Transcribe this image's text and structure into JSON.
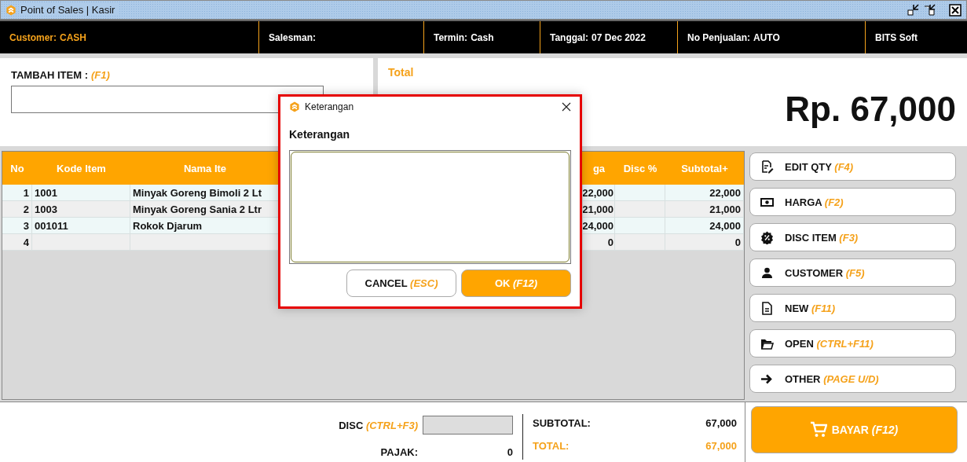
{
  "window": {
    "title": "Point of Sales | Kasir"
  },
  "info_bar": [
    {
      "label": "Customer:",
      "value": "CASH",
      "highlighted": true
    },
    {
      "label": "Salesman:",
      "highlighted": false
    },
    {
      "label": "Termin:",
      "value": "Cash",
      "highlighted": false
    },
    {
      "label": "Tanggal:",
      "value": "07 Dec 2022",
      "highlighted": false
    },
    {
      "label": "No Penjualan:",
      "value": "AUTO",
      "highlighted": false
    },
    {
      "label": "BITS Soft",
      "highlighted": false
    }
  ],
  "add_item": {
    "label": "TAMBAH ITEM :",
    "shortcut": "(F1)"
  },
  "total": {
    "label": "Total",
    "amount": "Rp. 67,000"
  },
  "table": {
    "columns": [
      "No",
      "Kode Item",
      "Nama Ite",
      "ga",
      "Disc %",
      "Subtotal+"
    ],
    "rows": [
      {
        "no": "1",
        "code": "1001",
        "name": "Minyak Goreng Bimoli 2 Lt",
        "price": "22,000",
        "subtotal": "22,000"
      },
      {
        "no": "2",
        "code": "1003",
        "name": "Minyak Goreng Sania 2 Ltr",
        "price": "21,000",
        "subtotal": "21,000"
      },
      {
        "no": "3",
        "code": "001011",
        "name": "Rokok Djarum",
        "price": "24,000",
        "subtotal": "24,000"
      },
      {
        "no": "4",
        "price": "0",
        "subtotal": "0"
      }
    ]
  },
  "actions": [
    {
      "label": "EDIT QTY",
      "shortcut": "(F4)"
    },
    {
      "label": "HARGA",
      "shortcut": "(F2)"
    },
    {
      "label": "DISC ITEM",
      "shortcut": "(F3)"
    },
    {
      "label": "CUSTOMER",
      "shortcut": "(F5)"
    },
    {
      "label": "NEW",
      "shortcut": "(F11)"
    },
    {
      "label": "OPEN",
      "shortcut": "(CTRL+F11)"
    },
    {
      "label": "OTHER",
      "shortcut": "(PAGE U/D)"
    }
  ],
  "pay_button": {
    "label": "BAYAR",
    "shortcut": "(F12)"
  },
  "summary": {
    "disc_label": "DISC",
    "disc_shortcut": "(CTRL+F3)",
    "tax_label": "PAJAK:",
    "tax": "0",
    "subtotal_label": "SUBTOTAL:",
    "subtotal": "67,000",
    "total_label": "TOTAL:",
    "total": "67,000"
  },
  "dialog": {
    "title": "Keterangan",
    "label": "Keterangan",
    "buttons": [
      {
        "label": "CANCEL",
        "shortcut": "(ESC)",
        "primary": false
      },
      {
        "label": "OK",
        "shortcut": "(F12)",
        "primary": true
      }
    ]
  }
}
